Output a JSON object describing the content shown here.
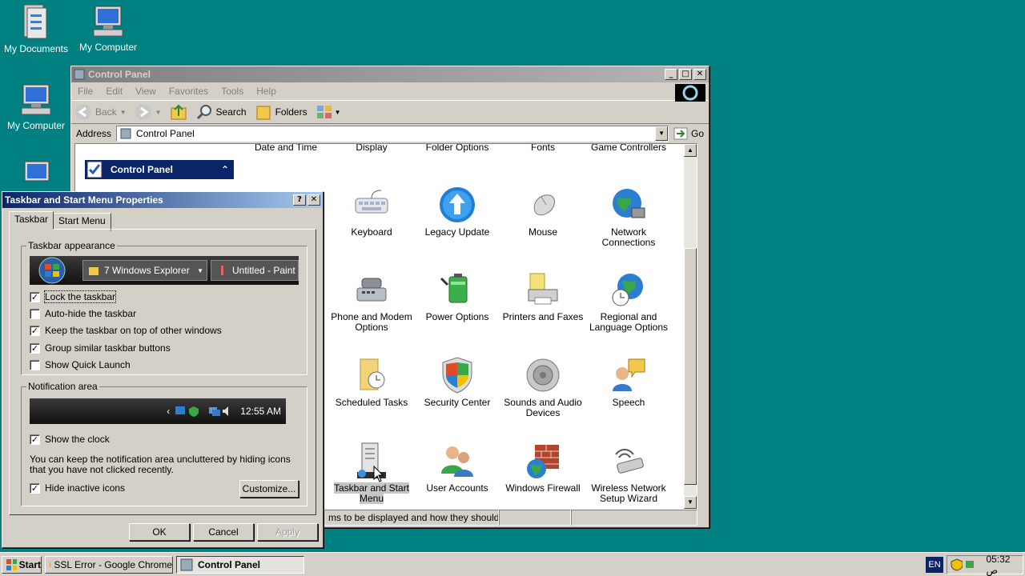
{
  "desktop": {
    "icons": [
      "My Documents",
      "My Computer",
      "My Computer"
    ]
  },
  "control_panel": {
    "title": "Control Panel",
    "menu": [
      "File",
      "Edit",
      "View",
      "Favorites",
      "Tools",
      "Help"
    ],
    "toolbar": {
      "back": "Back",
      "search": "Search",
      "folders": "Folders"
    },
    "address_label": "Address",
    "address_value": "Control Panel",
    "go_label": "Go",
    "sidebar_title": "Control Panel",
    "top_row_labels": [
      "Date and Time",
      "Display",
      "Folder Options",
      "Fonts",
      "Game Controllers"
    ],
    "items": [
      "Keyboard",
      "Legacy Update",
      "Mouse",
      "Network Connections",
      "Phone and Modem Options",
      "Power Options",
      "Printers and Faxes",
      "Regional and Language Options",
      "Scheduled Tasks",
      "Security Center",
      "Sounds and Audio Devices",
      "Speech",
      "Taskbar and Start Menu",
      "User Accounts",
      "Windows Firewall",
      "Wireless Network Setup Wizard"
    ],
    "status_text": "ms to be displayed and how they should app"
  },
  "dialog": {
    "title": "Taskbar and Start Menu Properties",
    "tabs": [
      "Taskbar",
      "Start Menu"
    ],
    "appearance_group": "Taskbar appearance",
    "preview_buttons": [
      "7 Windows Explorer",
      "Untitled - Paint"
    ],
    "options": [
      {
        "label": "Lock the taskbar",
        "checked": true
      },
      {
        "label": "Auto-hide the taskbar",
        "checked": false
      },
      {
        "label": "Keep the taskbar on top of other windows",
        "checked": true
      },
      {
        "label": "Group similar taskbar buttons",
        "checked": true
      },
      {
        "label": "Show Quick Launch",
        "checked": false
      }
    ],
    "notification_group": "Notification area",
    "preview_clock": "12:55 AM",
    "show_clock": {
      "label": "Show the clock",
      "checked": true
    },
    "notification_desc": "You can keep the notification area uncluttered by hiding icons that you have not clicked recently.",
    "hide_inactive": {
      "label": "Hide inactive icons",
      "checked": true
    },
    "customize": "Customize...",
    "ok": "OK",
    "cancel": "Cancel",
    "apply": "Apply"
  },
  "taskbar": {
    "start": "Start",
    "tasks": [
      "SSL Error - Google Chrome",
      "Control Panel"
    ],
    "lang": "EN",
    "clock": "05:32 ص"
  },
  "colors": {
    "desktop": "#008080",
    "title_active": "#0a246a",
    "face": "#d4d0c8"
  }
}
